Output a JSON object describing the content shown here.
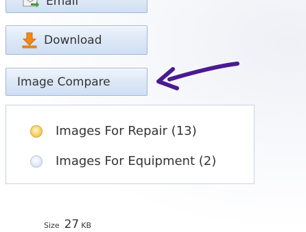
{
  "buttons": {
    "email_label": "Email",
    "download_label": "Download",
    "compare_label": "Image Compare"
  },
  "filter": {
    "options": [
      {
        "label": "Images For Repair (13)",
        "selected": true
      },
      {
        "label": "Images For Equipment (2)",
        "selected": false
      }
    ]
  },
  "file": {
    "size_label": "Size",
    "size_value": "27",
    "size_unit": "KB"
  },
  "colors": {
    "annotation_arrow": "#4b1a8f",
    "download_icon": "#f08a1c",
    "email_icon": "#3f9a3a",
    "button_border": "#9fb7d6"
  },
  "icons": {
    "email": "email-icon",
    "download": "download-arrow-icon",
    "annotation": "annotation-arrow-icon"
  }
}
